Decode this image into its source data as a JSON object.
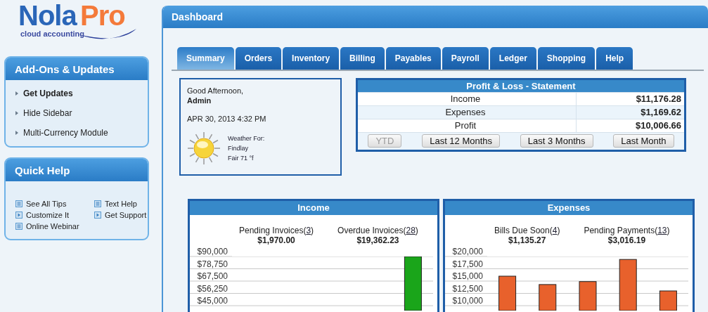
{
  "logo": {
    "word_1": "Nola",
    "word_2": "Pro",
    "tagline": "cloud accounting"
  },
  "sidebar": {
    "panels": [
      {
        "title": "Add-Ons & Updates",
        "kind": "list",
        "items": [
          {
            "label": "Get Updates",
            "bold": true
          },
          {
            "label": "Hide Sidebar",
            "bold": false
          },
          {
            "label": "Multi-Currency Module",
            "bold": false
          }
        ]
      },
      {
        "title": "Quick Help",
        "kind": "grid",
        "items": [
          {
            "label": "See All Tips",
            "kind": "doc"
          },
          {
            "label": "Text Help",
            "kind": "doc"
          },
          {
            "label": "Customize It",
            "kind": "video"
          },
          {
            "label": "Get Support",
            "kind": "video"
          },
          {
            "label": "Online Webinar",
            "kind": "doc"
          }
        ]
      }
    ]
  },
  "header": {
    "title": "Dashboard"
  },
  "tabs": [
    {
      "label": "Summary",
      "selected": true
    },
    {
      "label": "Orders",
      "selected": false
    },
    {
      "label": "Inventory",
      "selected": false
    },
    {
      "label": "Billing",
      "selected": false
    },
    {
      "label": "Payables",
      "selected": false
    },
    {
      "label": "Payroll",
      "selected": false
    },
    {
      "label": "Ledger",
      "selected": false
    },
    {
      "label": "Shopping",
      "selected": false
    },
    {
      "label": "Help",
      "selected": false
    }
  ],
  "greeting": {
    "salutation": "Good Afternoon,",
    "user": "Admin",
    "datetime": "APR 30, 2013 4:32 PM",
    "weather_label": "Weather For:",
    "city": "Findlay",
    "conditions": "Fair 71 °f"
  },
  "profit_loss": {
    "title": "Profit & Loss - Statement",
    "rows": [
      {
        "label": "Income",
        "value": "$11,176.28"
      },
      {
        "label": "Expenses",
        "value": "$1,169.62"
      },
      {
        "label": "Profit",
        "value": "$10,006.66"
      }
    ],
    "buttons": [
      {
        "label": "YTD",
        "disabled": true
      },
      {
        "label": "Last 12 Months",
        "disabled": false
      },
      {
        "label": "Last 3 Months",
        "disabled": false
      },
      {
        "label": "Last Month",
        "disabled": false
      }
    ]
  },
  "panels": [
    {
      "title": "Income",
      "summaries": [
        {
          "label": "Pending Invoices(",
          "count": "3",
          "tail": ")",
          "amount": "$1,970.00"
        },
        {
          "label": "Overdue Invoices(",
          "count": "28",
          "tail": ")",
          "amount": "$19,362.23"
        }
      ],
      "chart_data": {
        "type": "bar",
        "grid": true,
        "ylim": [
          40500,
          90000
        ],
        "yticks": [
          {
            "value": 90000,
            "label": "$90,000"
          },
          {
            "value": 78750,
            "label": "$78,750"
          },
          {
            "value": 67500,
            "label": "$67,500"
          },
          {
            "value": 56250,
            "label": "$56,250"
          },
          {
            "value": 45000,
            "label": "$45,000"
          }
        ],
        "series": [
          {
            "color": "#1aa51a",
            "values": [
              null,
              null,
              null,
              null,
              90000
            ]
          }
        ]
      }
    },
    {
      "title": "Expenses",
      "summaries": [
        {
          "label": "Bills Due Soon(",
          "count": "4",
          "tail": ")",
          "amount": "$1,135.27"
        },
        {
          "label": "Pending Payments(",
          "count": "13",
          "tail": ")",
          "amount": "$3,016.19"
        }
      ],
      "chart_data": {
        "type": "bar",
        "grid": true,
        "ylim": [
          9000,
          20000
        ],
        "yticks": [
          {
            "value": 20000,
            "label": "$20,000"
          },
          {
            "value": 17500,
            "label": "$17,500"
          },
          {
            "value": 15000,
            "label": "$15,000"
          },
          {
            "value": 12500,
            "label": "$12,500"
          },
          {
            "value": 10000,
            "label": "$10,000"
          }
        ],
        "series": [
          {
            "color": "#e8612c",
            "values": [
              16000,
              14300,
              14900,
              19400,
              13000
            ]
          }
        ]
      }
    }
  ]
}
